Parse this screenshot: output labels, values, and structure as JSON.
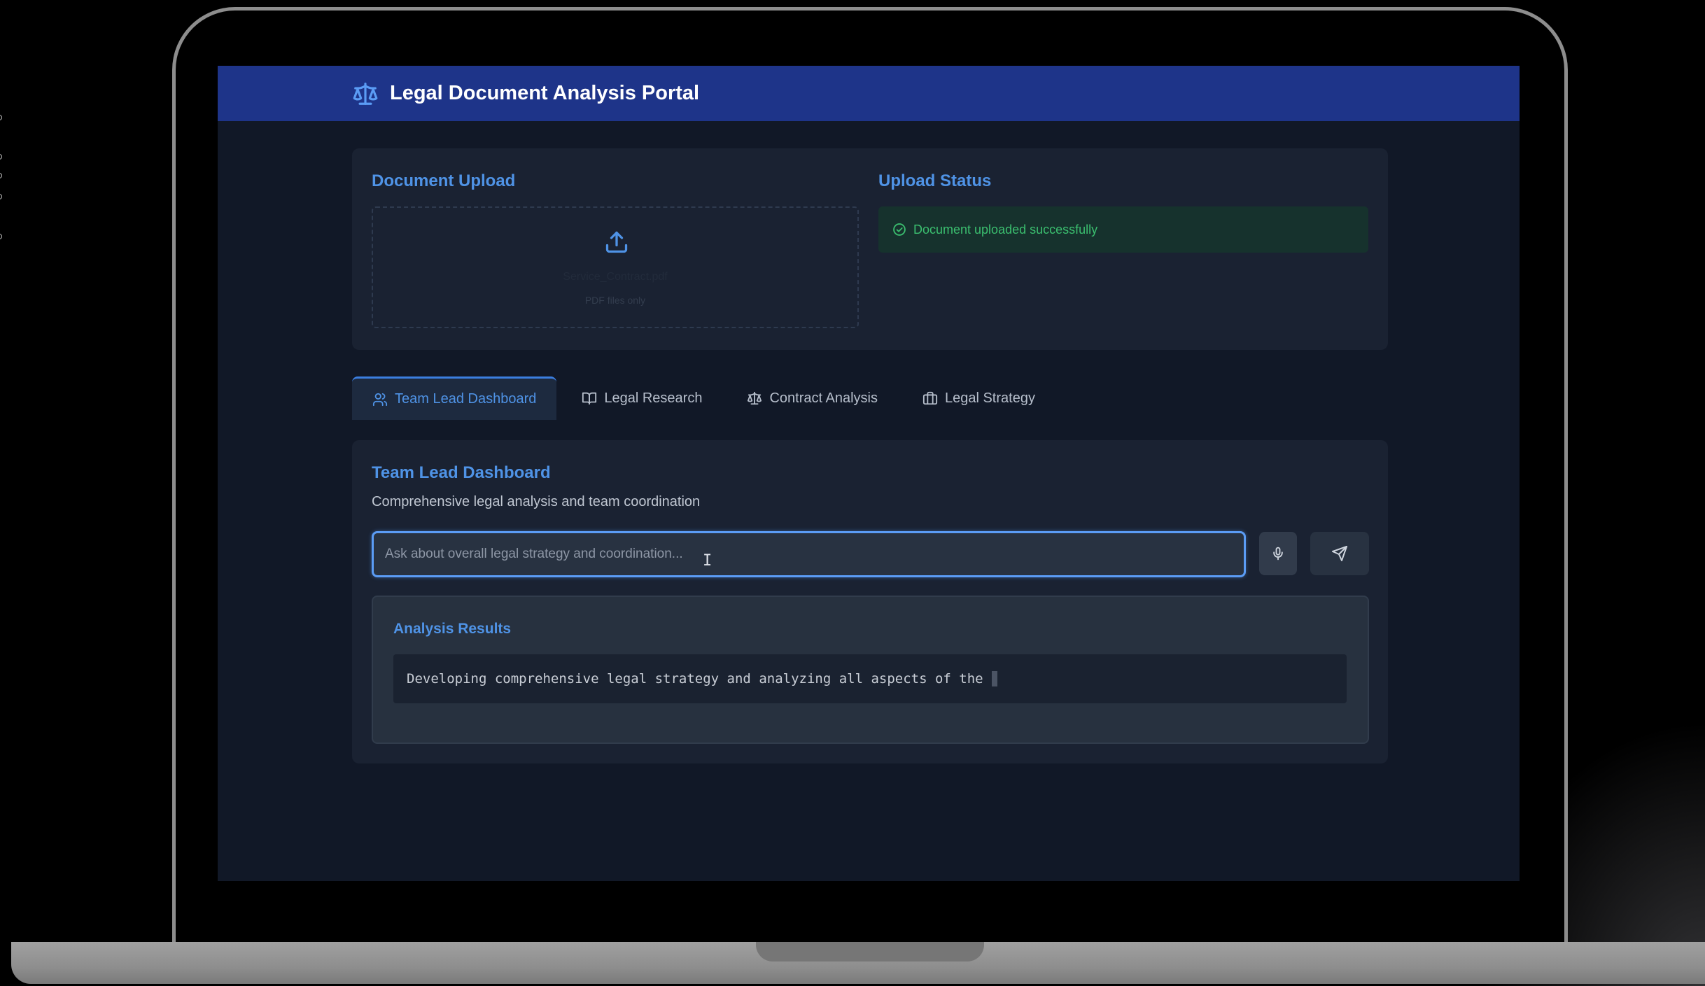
{
  "app": {
    "title": "Legal Document Analysis Portal",
    "logo_icon": "scale-icon"
  },
  "upload": {
    "title": "Document Upload",
    "file_name": "Service_Contract.pdf",
    "hint": "PDF files only",
    "icon": "upload-icon"
  },
  "status": {
    "title": "Upload Status",
    "message": "Document uploaded successfully",
    "icon": "check-circle-icon",
    "color": "#3bbf6f"
  },
  "tabs": [
    {
      "label": "Team Lead Dashboard",
      "icon": "users-icon",
      "active": true
    },
    {
      "label": "Legal Research",
      "icon": "book-icon",
      "active": false
    },
    {
      "label": "Contract Analysis",
      "icon": "scale-icon",
      "active": false
    },
    {
      "label": "Legal Strategy",
      "icon": "briefcase-icon",
      "active": false
    }
  ],
  "dashboard": {
    "title": "Team Lead Dashboard",
    "subtitle": "Comprehensive legal analysis and team coordination",
    "input_placeholder": "Ask about overall legal strategy and coordination...",
    "mic_icon": "microphone-icon",
    "send_icon": "send-icon"
  },
  "results": {
    "title": "Analysis Results",
    "text": "Developing comprehensive legal strategy and analyzing all aspects of the"
  },
  "colors": {
    "accent": "#4f93e6",
    "header": "#1e3489",
    "background": "#111827",
    "card": "#1a2232"
  }
}
